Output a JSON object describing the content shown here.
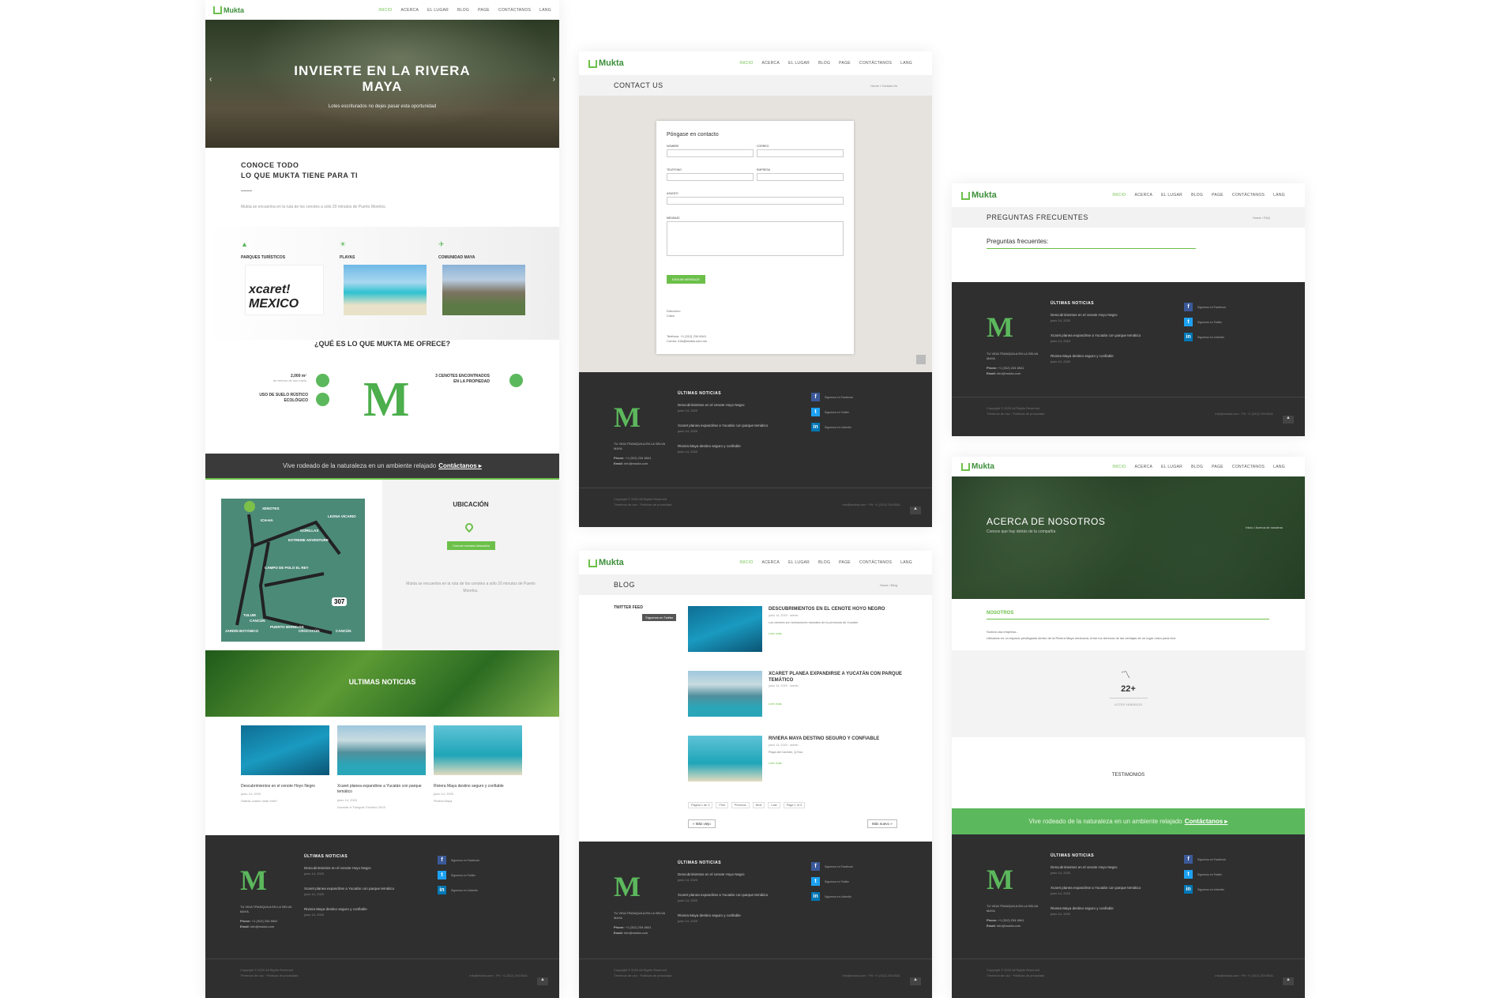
{
  "nav": {
    "logo": "Mukta",
    "items": [
      "INICIO",
      "ACERCA",
      "EL LUGAR",
      "BLOG",
      "PAGE",
      "CONTÁCTANOS",
      "LANG"
    ]
  },
  "home": {
    "hero_title": "INVIERTE EN LA RIVERA MAYA",
    "hero_sub": "Lotes escriturados no dejes pasar esta oportunidad",
    "intro_title_1": "CONOCE TODO",
    "intro_title_2": "LO QUE MUKTA TIENE PARA TI",
    "intro_text": "Mukta se encuentra en la ruta de los cenotes a sólo 20 minutos de Puerto Morelos.",
    "features": [
      {
        "label": "PARQUES TURÍSTICOS",
        "img": "xcaret",
        "img_text": "xcaret! MEXICO"
      },
      {
        "label": "PLAYAS",
        "img": "beach"
      },
      {
        "label": "COMUNIDAD MAYA",
        "img": "ruins"
      }
    ],
    "offer_title": "¿QUÉ ES LO QUE MUKTA ME OFRECE?",
    "offer_left": [
      {
        "title": "2,000 m²",
        "sub": "de terreno de uso mixto"
      },
      {
        "title": "USO DE SUELO RÚSTICO ECOLÓGICO",
        "sub": ""
      }
    ],
    "offer_right": [
      {
        "title": "3 CENOTES ENCONTRADOS EN LA PROPIEDAD",
        "sub": ""
      }
    ],
    "cta_text": "Vive rodeado de la naturaleza en un ambiente relajado",
    "cta_link": "Contáctanos",
    "map_labels": [
      "XENOTES",
      "ICH-HA",
      "LEONA VICARIO",
      "EXTREME ADVENTURE",
      "GORILLAS",
      "CAMPO DE POLO EL REY",
      "TULUM",
      "CANCÚN",
      "JARDÍN BOTÁNICO",
      "PUERTO MORELOS",
      "CROCOCÚN",
      "CANCÚN",
      "307"
    ],
    "ubicacion_title": "UBICACIÓN",
    "ubicacion_btn": "Conoce nuestra Ubicación",
    "ubicacion_text": "Mukta se encuentra en la ruta de los cenotes a sólo 20 minutos de Puerto Morelos.",
    "news_banner": "ULTIMAS NOTICIAS",
    "news": [
      {
        "title": "Descubrimientos en el cenote Hoyo Negro",
        "date": "junio 14, 2020",
        "text": "Sabías cuanto mide este?"
      },
      {
        "title": "Xcaret planea expandirse a Yucatán con parque temático",
        "date": "junio 14, 2020",
        "text": "Durante el Tianguis Turístico 2019"
      },
      {
        "title": "Riviera Maya destino seguro y confiable",
        "date": "junio 14, 2020",
        "text": "Riviera Maya"
      }
    ]
  },
  "footer": {
    "tagline": "TU VIDA TRANQUILA EN LA SELVA MAYA",
    "phone_label": "Phone:",
    "phone": "+1 (312) 234 6541",
    "email_label": "Email:",
    "email": "info@mukta.com",
    "news_title": "ÚLTIMAS NOTICIAS",
    "news": [
      {
        "title": "Descubrimientos en el cenote Hoyo Negro",
        "date": "junio 14, 2020"
      },
      {
        "title": "Xcaret planea expandirse a Yucatán con parque temático",
        "date": "junio 14, 2020"
      },
      {
        "title": "Riviera Maya destino seguro y confiable",
        "date": "junio 14, 2020"
      }
    ],
    "social": [
      "Síguenos en Facebook",
      "Síguenos en Twitter",
      "Síguenos en LinkedIn"
    ],
    "copyright": "Copyright © 2020 All Rights Reserved",
    "links": "Términos de uso · Políticas de privacidad",
    "contact_right": "info@mukta.com · Ph: +1 (312) 234 6541"
  },
  "contact": {
    "page_title": "CONTACT US",
    "crumb": "Home / Contact Us",
    "form_title": "Póngase en contacto",
    "fields": [
      "NOMBRE",
      "CORREO",
      "TELÉFONO",
      "EMPRESA",
      "ASUNTO",
      "MENSAJE"
    ],
    "submit": "ENVIAR MENSAJE",
    "addr_label": "Dirección:",
    "addr": "Cuba",
    "tel_label": "Teléfono:",
    "tel": "+1 (312) 234 6541",
    "mail_label": "Correo:",
    "mail": "info@mukta.com.mx"
  },
  "blog": {
    "page_title": "BLOG",
    "crumb": "Home / Blog",
    "sidebar_title": "TWITTER FEED",
    "sidebar_btn": "Síguenos en Twitter",
    "posts": [
      {
        "title": "DESCUBRIMIENTOS EN EL CENOTE HOYO NEGRO",
        "meta": "junio 14, 2020 · admin",
        "text": "Los cenotes son formaciones naturales de la península de Yucatán.",
        "more": "Leer más"
      },
      {
        "title": "XCARET PLANEA EXPANDIRSE A YUCATÁN CON PARQUE TEMÁTICO",
        "meta": "junio 14, 2020 · admin",
        "text": "",
        "more": "Leer más"
      },
      {
        "title": "RIVIERA MAYA DESTINO SEGURO Y CONFIABLE",
        "meta": "junio 14, 2020 · admin",
        "text": "Playa del Carmen, Q.Roo",
        "more": "Leer más"
      }
    ],
    "pager": [
      "Página 1 de 3",
      "First",
      "Previous",
      "Next",
      "Last",
      "Page 1 of 3"
    ],
    "prev_btn": "« Más viejo",
    "next_btn": "Más nuevo »"
  },
  "faq": {
    "page_title": "PREGUNTAS FRECUENTES",
    "crumb": "Home / FAQ",
    "heading": "Preguntas frecuentes:"
  },
  "about": {
    "hero_title": "ACERCA DE NOSOTROS",
    "hero_sub": "Conoce que hay detrás de la compañía",
    "crumb": "Inicio / Acerca de nosotros",
    "section": "NOSOTROS",
    "text_1": "Somos una empresa...",
    "text_2": "Ubicados en un espacio privilegiado dentro de la Riviera Maya mexicana, entre los terrenos de las ventajas de un lugar único para vivir.",
    "stat_value": "22+",
    "stat_label": "LOTES VENDIDOS",
    "testimonials": "TESTIMONIOS",
    "cta_text": "Vive rodeado de la naturaleza en un ambiente relajado",
    "cta_link": "Contáctanos"
  }
}
